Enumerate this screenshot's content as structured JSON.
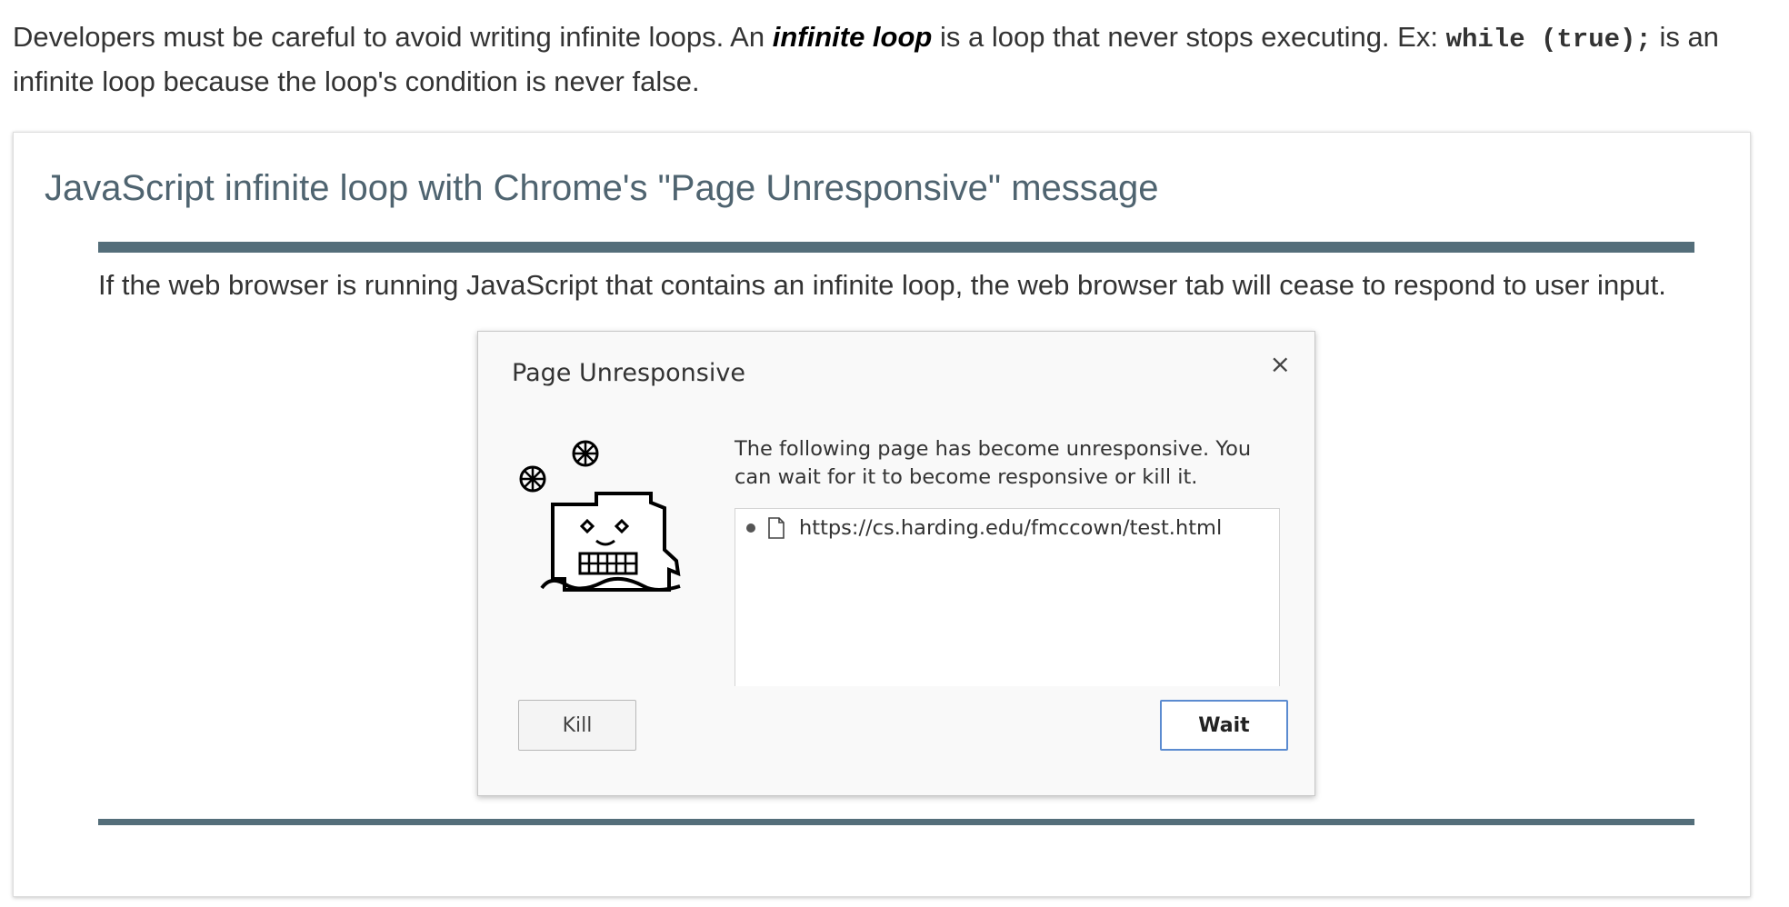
{
  "intro": {
    "text_before": "Developers must be careful to avoid writing infinite loops. An ",
    "term": "infinite loop",
    "text_middle": " is a loop that never stops executing. Ex: ",
    "code": "while (true);",
    "text_after": " is an infinite loop because the loop's condition is never false."
  },
  "figure": {
    "title": "JavaScript infinite loop with Chrome's \"Page Unresponsive\" message",
    "caption": "If the web browser is running JavaScript that contains an infinite loop, the web browser tab will cease to respond to user input.",
    "accent_color": "#546e7a"
  },
  "dialog": {
    "title": "Page Unresponsive",
    "close_glyph": "×",
    "message": "The following page has become unresponsive. You can wait for it to become responsive or kill it.",
    "pages": [
      {
        "url": "https://cs.harding.edu/fmccown/test.html",
        "icon": "page-icon"
      }
    ],
    "kill_label": "Kill",
    "wait_label": "Wait",
    "illustration_icon": "dead-tab-icon"
  }
}
